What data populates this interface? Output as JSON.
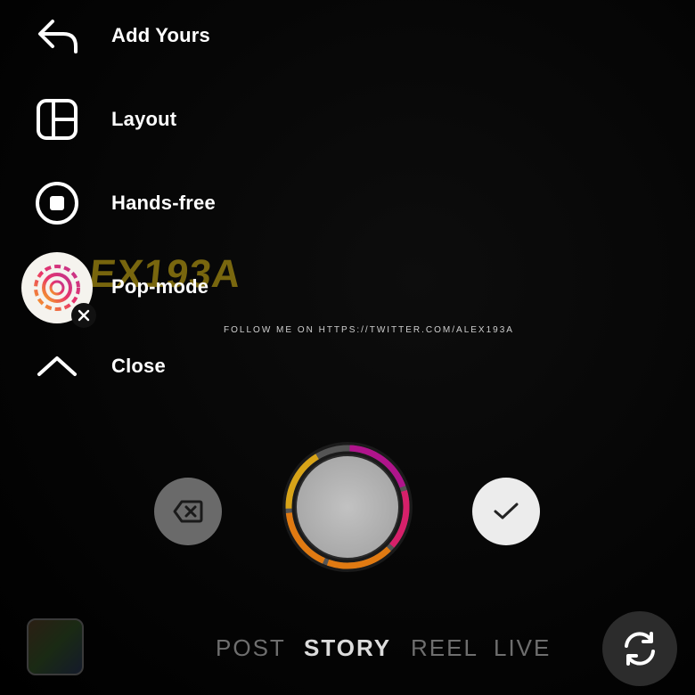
{
  "menu": {
    "add_yours": "Add Yours",
    "layout": "Layout",
    "hands_free": "Hands-free",
    "pop_mode": "Pop-mode",
    "close": "Close"
  },
  "watermark": {
    "logo_text": "ALEX193A",
    "follow_text": "FOLLOW ME ON HTTPS://TWITTER.COM/ALEX193A"
  },
  "modes": [
    {
      "label": "POST",
      "active": false
    },
    {
      "label": "STORY",
      "active": true
    },
    {
      "label": "REEL",
      "active": false
    },
    {
      "label": "LIVE",
      "active": false
    }
  ],
  "icons": {
    "add_yours": "reply-arrow-icon",
    "layout": "layout-grid-icon",
    "hands_free": "stop-circle-icon",
    "pop_mode": "pop-mode-icon",
    "close": "chevron-up-icon",
    "delete": "backspace-icon",
    "done": "checkmark-icon",
    "flip": "flip-camera-icon"
  },
  "colors": {
    "background": "#000000",
    "ring_purple": "#b0148c",
    "ring_pink": "#d6206a",
    "ring_orange": "#e07a12",
    "ring_yellow": "#d8a418"
  },
  "recording_progress": 0.92
}
